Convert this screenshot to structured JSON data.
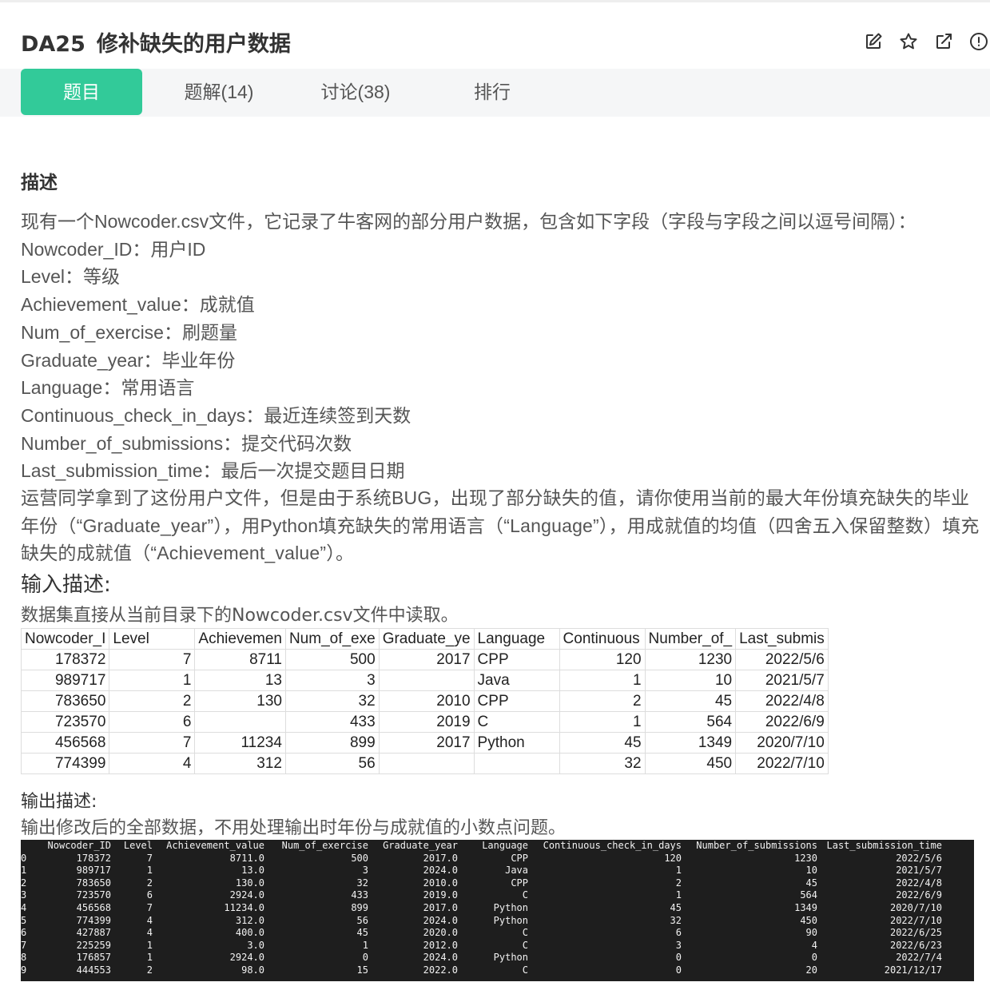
{
  "problem": {
    "code": "DA25",
    "title": "修补缺失的用户数据"
  },
  "toolbar": {
    "icons": [
      "edit-icon",
      "star-icon",
      "share-icon",
      "report-icon"
    ]
  },
  "tabs": [
    {
      "label": "题目",
      "active": true
    },
    {
      "label": "题解(14)",
      "active": false
    },
    {
      "label": "讨论(38)",
      "active": false
    },
    {
      "label": "排行",
      "active": false
    }
  ],
  "colors": {
    "accent": "#32ca99",
    "tabbar_bg": "#f5f6f7",
    "console_bg": "#1e1e1e"
  },
  "description": {
    "heading": "描述",
    "lines": [
      "现有一个Nowcoder.csv文件，它记录了牛客网的部分用户数据，包含如下字段（字段与字段之间以逗号间隔）：",
      "Nowcoder_ID：用户ID",
      "Level：等级",
      "Achievement_value：成就值",
      "Num_of_exercise：刷题量",
      "Graduate_year：毕业年份",
      "Language：常用语言",
      "Continuous_check_in_days：最近连续签到天数",
      "Number_of_submissions：提交代码次数",
      "Last_submission_time：最后一次提交题目日期"
    ],
    "paragraph": "运营同学拿到了这份用户文件，但是由于系统BUG，出现了部分缺失的值，请你使用当前的最大年份填充缺失的毕业年份（“Graduate_year”），用Python填充缺失的常用语言（“Language”），用成就值的均值（四舍五入保留整数）填充缺失的成就值（“Achievement_value”）。"
  },
  "input": {
    "heading": "输入描述:",
    "text": "数据集直接从当前目录下的Nowcoder.csv文件中读取。",
    "table": {
      "headers": [
        "Nowcoder_I",
        "Level",
        "Achievemen",
        "Num_of_exe",
        "Graduate_ye",
        "Language",
        "Continuous",
        "Number_of_",
        "Last_submis"
      ],
      "rows": [
        [
          "178372",
          "7",
          "8711",
          "500",
          "2017",
          "CPP",
          "120",
          "1230",
          "2022/5/6"
        ],
        [
          "989717",
          "1",
          "13",
          "3",
          "",
          "Java",
          "1",
          "10",
          "2021/5/7"
        ],
        [
          "783650",
          "2",
          "130",
          "32",
          "2010",
          "CPP",
          "2",
          "45",
          "2022/4/8"
        ],
        [
          "723570",
          "6",
          "",
          "433",
          "2019",
          "C",
          "1",
          "564",
          "2022/6/9"
        ],
        [
          "456568",
          "7",
          "11234",
          "899",
          "2017",
          "Python",
          "45",
          "1349",
          "2020/7/10"
        ],
        [
          "774399",
          "4",
          "312",
          "56",
          "",
          "",
          "32",
          "450",
          "2022/7/10"
        ]
      ]
    }
  },
  "output": {
    "heading": "输出描述:",
    "text": "输出修改后的全部数据，不用处理输出时年份与成就值的小数点问题。",
    "console": {
      "headers": [
        "",
        "Nowcoder_ID",
        "Level",
        "Achievement_value",
        "Num_of_exercise",
        "Graduate_year",
        "Language",
        "Continuous_check_in_days",
        "Number_of_submissions",
        "Last_submission_time"
      ],
      "rows": [
        [
          "0",
          "178372",
          "7",
          "8711.0",
          "500",
          "2017.0",
          "CPP",
          "120",
          "1230",
          "2022/5/6"
        ],
        [
          "1",
          "989717",
          "1",
          "13.0",
          "3",
          "2024.0",
          "Java",
          "1",
          "10",
          "2021/5/7"
        ],
        [
          "2",
          "783650",
          "2",
          "130.0",
          "32",
          "2010.0",
          "CPP",
          "2",
          "45",
          "2022/4/8"
        ],
        [
          "3",
          "723570",
          "6",
          "2924.0",
          "433",
          "2019.0",
          "C",
          "1",
          "564",
          "2022/6/9"
        ],
        [
          "4",
          "456568",
          "7",
          "11234.0",
          "899",
          "2017.0",
          "Python",
          "45",
          "1349",
          "2020/7/10"
        ],
        [
          "5",
          "774399",
          "4",
          "312.0",
          "56",
          "2024.0",
          "Python",
          "32",
          "450",
          "2022/7/10"
        ],
        [
          "6",
          "427887",
          "4",
          "400.0",
          "45",
          "2020.0",
          "C",
          "6",
          "90",
          "2022/6/25"
        ],
        [
          "7",
          "225259",
          "1",
          "3.0",
          "1",
          "2012.0",
          "C",
          "3",
          "4",
          "2022/6/23"
        ],
        [
          "8",
          "176857",
          "1",
          "2924.0",
          "0",
          "2024.0",
          "Python",
          "0",
          "0",
          "2022/7/4"
        ],
        [
          "9",
          "444553",
          "2",
          "98.0",
          "15",
          "2022.0",
          "C",
          "0",
          "20",
          "2021/12/17"
        ]
      ]
    }
  }
}
